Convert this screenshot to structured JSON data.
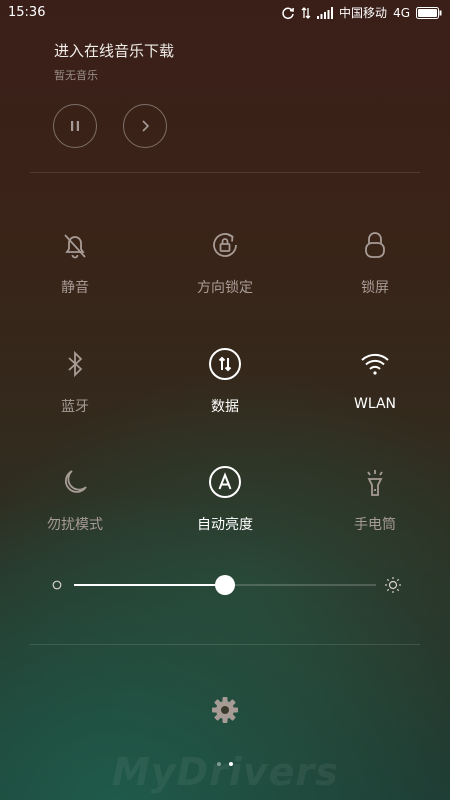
{
  "status_bar": {
    "time": "15:36",
    "carrier": "中国移动",
    "network": "4G"
  },
  "music": {
    "title": "进入在线音乐下载",
    "subtitle": "暂无音乐"
  },
  "toggles": [
    {
      "label": "静音",
      "icon": "bell-off-icon",
      "active": false
    },
    {
      "label": "方向锁定",
      "icon": "rotation-lock-icon",
      "active": false
    },
    {
      "label": "锁屏",
      "icon": "lock-icon",
      "active": false
    },
    {
      "label": "蓝牙",
      "icon": "bluetooth-icon",
      "active": false
    },
    {
      "label": "数据",
      "icon": "mobile-data-icon",
      "active": true
    },
    {
      "label": "WLAN",
      "icon": "wifi-icon",
      "active": true
    },
    {
      "label": "勿扰模式",
      "icon": "moon-icon",
      "active": false
    },
    {
      "label": "自动亮度",
      "icon": "auto-brightness-icon",
      "active": true
    },
    {
      "label": "手电筒",
      "icon": "flashlight-icon",
      "active": false
    }
  ],
  "brightness": {
    "level": 0.5
  },
  "pager": {
    "pages": 2,
    "current": 1
  },
  "watermark": "MyDrivers"
}
